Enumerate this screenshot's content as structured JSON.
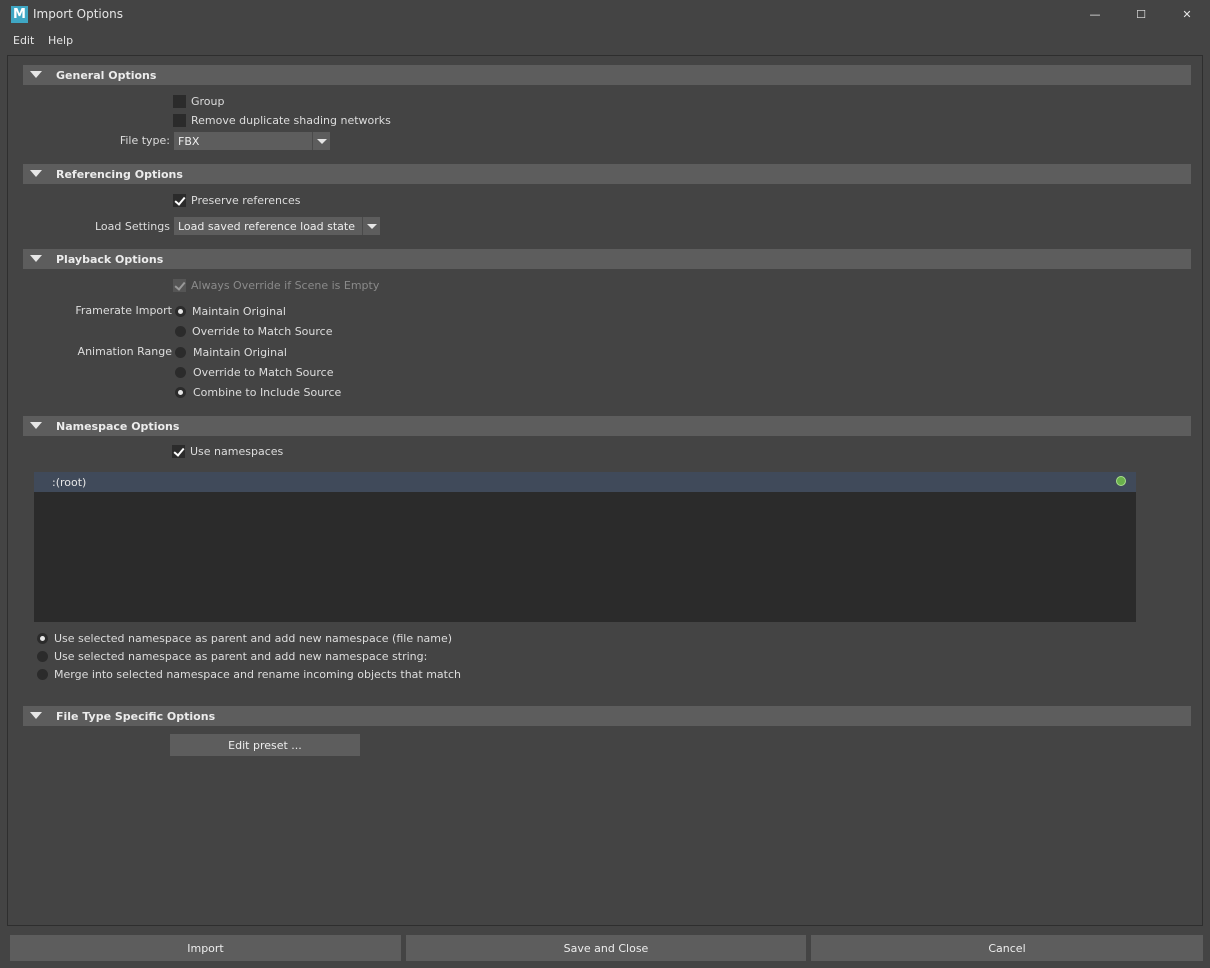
{
  "window": {
    "title": "Import Options",
    "app_icon_letter": "M",
    "controls": {
      "minimize": "—",
      "maximize": "☐",
      "close": "✕"
    }
  },
  "menu": [
    "Edit",
    "Help"
  ],
  "sections": {
    "general": {
      "title": "General Options",
      "group_label": "Group",
      "group_checked": false,
      "remove_dup_label": "Remove duplicate shading networks",
      "remove_dup_checked": false,
      "file_type_label": "File type:",
      "file_type_value": "FBX"
    },
    "referencing": {
      "title": "Referencing Options",
      "preserve_label": "Preserve references",
      "preserve_checked": true,
      "load_settings_label": "Load Settings",
      "load_settings_value": "Load saved reference load state"
    },
    "playback": {
      "title": "Playback Options",
      "always_override_label": "Always Override if Scene is Empty",
      "framerate_label": "Framerate Import",
      "framerate_options": [
        "Maintain Original",
        "Override to Match Source"
      ],
      "framerate_selected": 0,
      "anim_range_label": "Animation Range",
      "anim_range_options": [
        "Maintain Original",
        "Override to Match Source",
        "Combine to Include Source"
      ],
      "anim_range_selected": 2
    },
    "namespace": {
      "title": "Namespace Options",
      "use_namespaces_label": "Use namespaces",
      "use_namespaces_checked": true,
      "root_item": ":(root)",
      "merge_options": [
        "Use selected namespace as parent and add new namespace (file name)",
        "Use selected namespace as parent and add new namespace string:",
        "Merge into selected namespace and rename incoming objects that match"
      ],
      "merge_selected": 0
    },
    "filetype": {
      "title": "File Type Specific Options",
      "edit_preset_label": "Edit preset ..."
    }
  },
  "buttons": {
    "import": "Import",
    "save_close": "Save and Close",
    "cancel": "Cancel"
  },
  "colors": {
    "background": "#444444",
    "header": "#5d5d5d",
    "field": "#2b2b2b",
    "selection": "#404a5a",
    "status_dot": "#6ab04c"
  }
}
